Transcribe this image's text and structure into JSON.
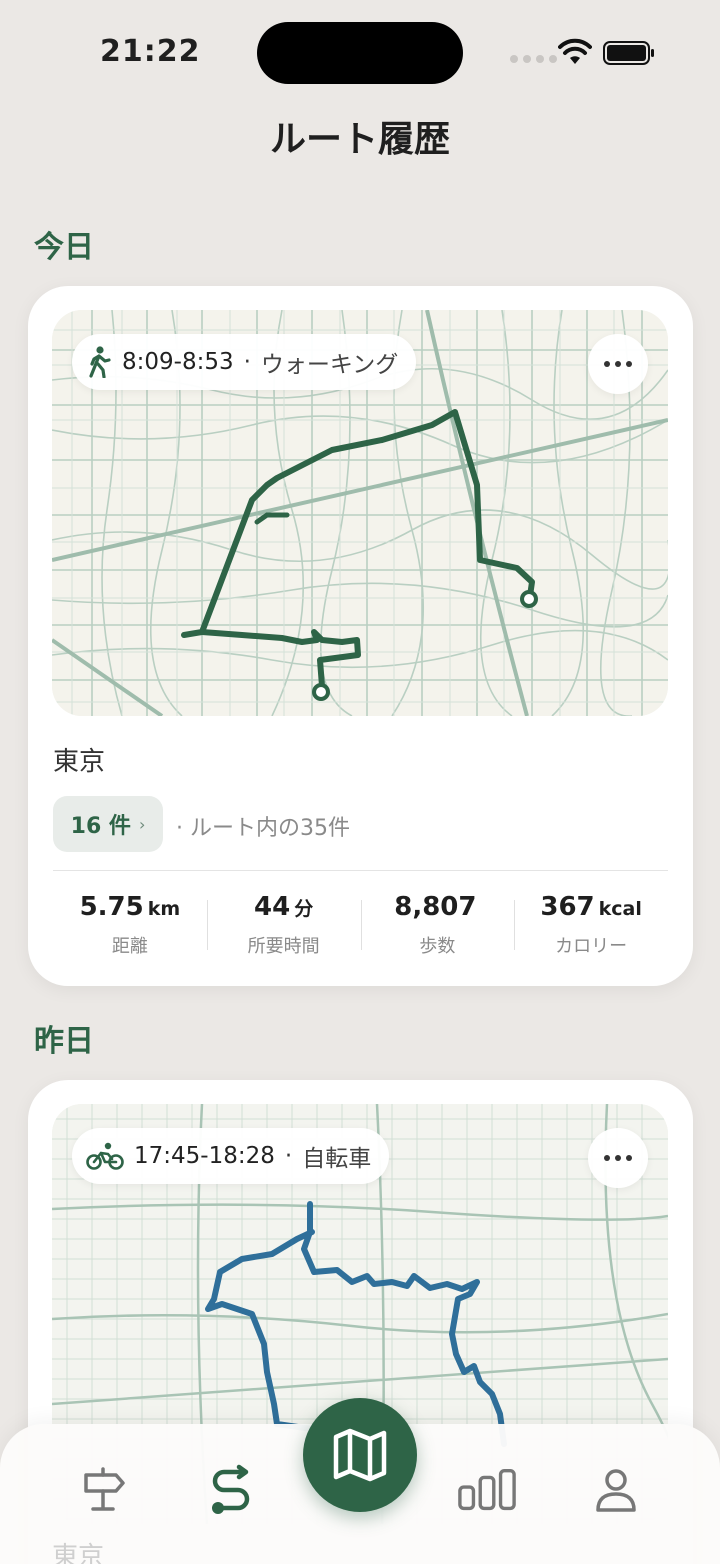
{
  "status_bar": {
    "time": "21:22"
  },
  "page_title": "ルート履歴",
  "sections": [
    {
      "label": "今日",
      "route": {
        "time_range": "8:09-8:53",
        "separator": "·",
        "mode": "ウォーキング",
        "mode_icon": "walking-icon",
        "route_color": "#2e6447",
        "location": "東京",
        "count_label": "16 件",
        "count_note": "· ルート内の35件",
        "stats": [
          {
            "value": "5.75",
            "unit": "km",
            "label": "距離"
          },
          {
            "value": "44",
            "unit": "分",
            "label": "所要時間"
          },
          {
            "value": "8,807",
            "unit": "",
            "label": "歩数"
          },
          {
            "value": "367",
            "unit": "kcal",
            "label": "カロリー"
          }
        ]
      }
    },
    {
      "label": "昨日",
      "route": {
        "time_range": "17:45-18:28",
        "separator": "·",
        "mode": "自転車",
        "mode_icon": "bicycle-icon",
        "route_color": "#2f6f9a",
        "location": "東京"
      }
    }
  ],
  "tabbar": {
    "items": [
      {
        "icon": "signpost-icon",
        "active": false
      },
      {
        "icon": "route-icon",
        "active": true
      },
      {
        "icon": "map-icon",
        "active": false
      },
      {
        "icon": "stats-icon",
        "active": false
      },
      {
        "icon": "profile-icon",
        "active": false
      }
    ]
  },
  "colors": {
    "accent": "#2e6447",
    "background": "#ebe8e5",
    "card": "#ffffff"
  }
}
